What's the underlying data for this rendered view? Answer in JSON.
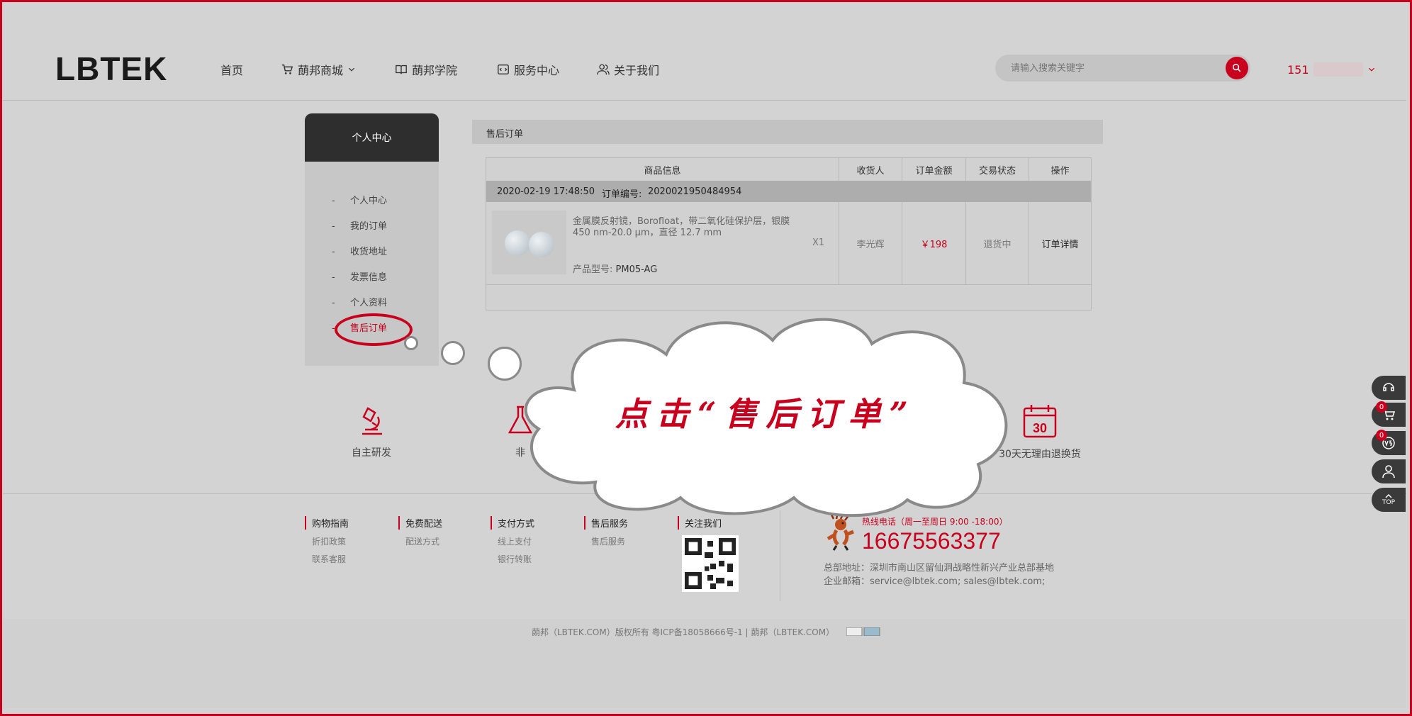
{
  "header": {
    "logo": "LBTEK",
    "nav": [
      {
        "label": "首页",
        "icon": "none"
      },
      {
        "label": "蓢邦商城",
        "icon": "cart-icon"
      },
      {
        "label": "蓢邦学院",
        "icon": "book-icon"
      },
      {
        "label": "服务中心",
        "icon": "service-icon"
      },
      {
        "label": "关于我们",
        "icon": "people-icon"
      }
    ],
    "search_placeholder": "请输入搜索关键字",
    "user": "151"
  },
  "sidebar": {
    "title": "个人中心",
    "items": [
      "个人中心",
      "我的订单",
      "收货地址",
      "发票信息",
      "个人资料",
      "售后订单"
    ],
    "active": "售后订单",
    "dash": "-"
  },
  "main": {
    "title": "售后订单",
    "columns": [
      "商品信息",
      "收货人",
      "订单金额",
      "交易状态",
      "操作"
    ],
    "order": {
      "datetime": "2020-02-19 17:48:50",
      "number_label": "订单编号:",
      "number": "2020021950484954",
      "product_desc": "金属膜反射镜，Borofloat，带二氧化硅保护层，银膜 450 nm-20.0 μm，直径 12.7 mm",
      "model_label": "产品型号:",
      "model": "PM05-AG",
      "qty": "X1",
      "receiver": "李光辉",
      "amount": "￥198",
      "status": "退货中",
      "action": "订单详情"
    }
  },
  "features": [
    {
      "label": "自主研发",
      "icon": "microscope-icon"
    },
    {
      "label": "非",
      "icon": "flask-icon"
    },
    {
      "label": "30天无理由退换货",
      "icon": "calendar-30-icon",
      "day": "30"
    }
  ],
  "footer": {
    "cols": [
      {
        "title": "购物指南",
        "links": [
          "折扣政策",
          "联系客服"
        ]
      },
      {
        "title": "免费配送",
        "links": [
          "配送方式"
        ]
      },
      {
        "title": "支付方式",
        "links": [
          "线上支付",
          "银行转账"
        ]
      },
      {
        "title": "售后服务",
        "links": [
          "售后服务"
        ]
      },
      {
        "title": "关注我们",
        "links": []
      }
    ],
    "hotline_label": "热线电话（周一至周日 9:00 -18:00）",
    "hotline": "16675563377",
    "address": "总部地址：深圳市南山区留仙洞战略性新兴产业总部基地",
    "email": "企业邮箱：service@lbtek.com; sales@lbtek.com;",
    "copyright": "蓢邦（LBTEK.COM）版权所有 粤ICP备18058666号-1 | 蓢邦（LBTEK.COM）"
  },
  "tools": {
    "cart_badge": "0",
    "compare_badge": "0",
    "top_label": "TOP"
  },
  "callout": "点击“售后订单”",
  "colors": {
    "accent": "#c8001e",
    "dark": "#2e2e2e"
  }
}
